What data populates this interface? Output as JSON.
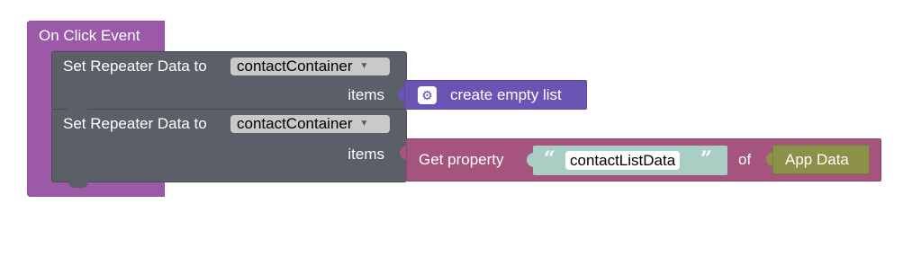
{
  "event_block": {
    "label": "On Click Event",
    "color": "#9b59a8"
  },
  "statements": [
    {
      "label": "Set Repeater Data to",
      "dropdown_value": "contactContainer",
      "items_label": "items"
    },
    {
      "label": "Set Repeater Data to",
      "dropdown_value": "contactContainer",
      "items_label": "items"
    }
  ],
  "list_block": {
    "label": "create empty list",
    "icon": "gear-icon",
    "color": "#6a55b5"
  },
  "property_block": {
    "label": "Get property",
    "text_value": "contactListData",
    "of_label": "of",
    "target_label": "App Data",
    "color": "#a5547e",
    "text_color": "#a9cec3",
    "target_color": "#8c914a"
  }
}
